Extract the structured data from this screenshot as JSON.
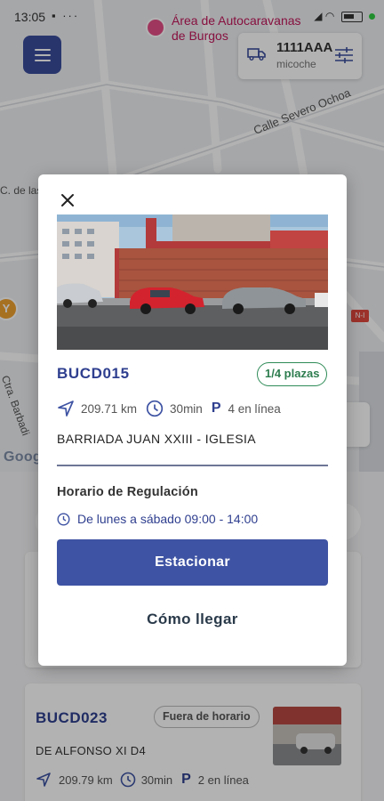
{
  "status_bar": {
    "time": "13:05",
    "left_icons": "▪ ···"
  },
  "map": {
    "poi_label": "Área de Autocaravanas de Burgos",
    "street_1": "Calle Severo Ochoa",
    "street_2": "C. de las",
    "street_3": "Ctra. Barbadi",
    "google_logo": "Google",
    "road_badge": "N-I"
  },
  "vehicle": {
    "plate": "1111AAA",
    "name": "micoche"
  },
  "modal": {
    "code": "BUCD015",
    "availability": "1/4 plazas",
    "distance": "209.71 km",
    "duration": "30min",
    "parking_letter": "P",
    "parking_online": "4 en línea",
    "address": "BARRIADA JUAN XXIII - IGLESIA",
    "schedule_title": "Horario de Regulación",
    "schedule_text": "De lunes a sábado 09:00 - 14:00",
    "primary_button": "Estacionar",
    "secondary_button": "Cómo llegar"
  },
  "list": {
    "card2": {
      "code": "BUCD023",
      "status": "Fuera de horario",
      "address": "DE ALFONSO XI  D4",
      "distance": "209.79 km",
      "duration": "30min",
      "parking_letter": "P",
      "parking_online": "2 en línea"
    }
  },
  "colors": {
    "brand": "#3e53a3",
    "code_text": "#2f3f8f",
    "available_green": "#2e8b57",
    "poi_pink": "#e44e86"
  }
}
